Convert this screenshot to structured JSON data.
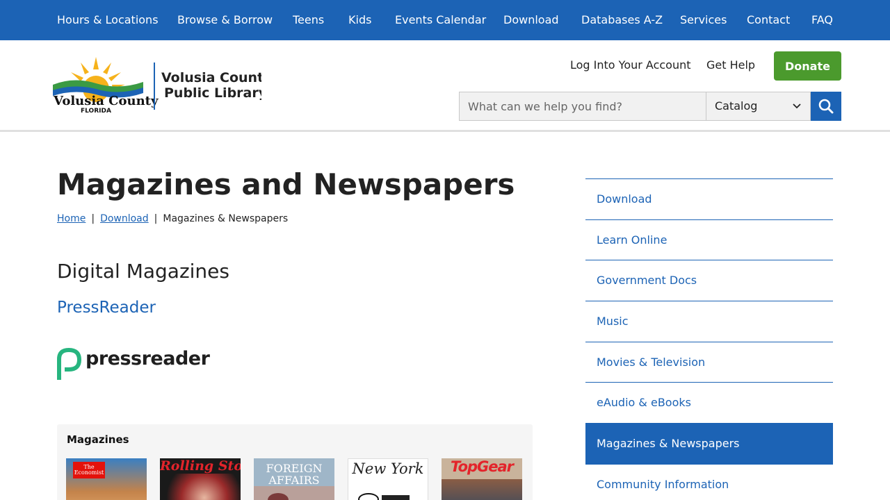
{
  "top_nav": [
    "Hours & Locations",
    "Browse & Borrow",
    "Teens",
    "Kids",
    "Events Calendar",
    "Download",
    "Databases A-Z",
    "Services",
    "Contact",
    "FAQ"
  ],
  "header": {
    "logo_county": "Volusia County",
    "logo_state": "FLORIDA",
    "logo_library_line1": "Volusia County",
    "logo_library_line2": "Public Library",
    "login_link": "Log Into Your Account",
    "help_link": "Get Help",
    "donate_label": "Donate",
    "search_placeholder": "What can we help you find?",
    "search_scope": "Catalog"
  },
  "page": {
    "title": "Magazines and Newspapers",
    "breadcrumb": {
      "home": "Home",
      "parent": "Download",
      "current": "Magazines & Newspapers",
      "separator": "|"
    },
    "section_heading": "Digital Magazines",
    "resource_link": "PressReader",
    "resource_logo_text": "pressreader",
    "panel_label": "Magazines",
    "covers": [
      {
        "title": "The Economist"
      },
      {
        "title": "Rolling Stone"
      },
      {
        "title": "FOREIGN AFFAIRS"
      },
      {
        "title": "New York"
      },
      {
        "title": "TopGear"
      }
    ]
  },
  "side_nav": [
    {
      "label": "Download",
      "active": false
    },
    {
      "label": "Learn Online",
      "active": false
    },
    {
      "label": "Government Docs",
      "active": false
    },
    {
      "label": "Music",
      "active": false
    },
    {
      "label": "Movies & Television",
      "active": false
    },
    {
      "label": "eAudio & eBooks",
      "active": false
    },
    {
      "label": "Magazines & Newspapers",
      "active": true
    },
    {
      "label": "Community Information",
      "active": false
    }
  ],
  "colors": {
    "primary_blue": "#1c63b5",
    "donate_green": "#4b9a2d",
    "pressreader_green": "#27b57f"
  }
}
